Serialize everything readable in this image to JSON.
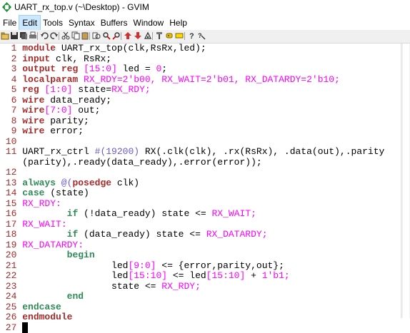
{
  "window": {
    "title": "UART_rx_top.v (~\\Desktop) - GVIM"
  },
  "menu": [
    "File",
    "Edit",
    "Tools",
    "Syntax",
    "Buffers",
    "Window",
    "Help"
  ],
  "menu_active_index": 1,
  "toolbar_icons": [
    "open-icon",
    "save-icon",
    "save-all-icon",
    "print-icon",
    "undo-icon",
    "redo-icon",
    "cut-icon",
    "copy-icon",
    "paste-icon",
    "replace-icon",
    "find-next-icon",
    "find-prev-icon",
    "load-session-icon",
    "save-session-icon",
    "run-script-icon",
    "make-icon",
    "shell-icon",
    "tags-icon",
    "help-icon",
    "find-help-icon"
  ],
  "colors": {
    "line_number": "#a52a2a",
    "keyword": "#a52a2a",
    "statement": "#2e8b57",
    "number": "#ff00ff",
    "special": "#6a5acd"
  },
  "lines": [
    {
      "n": "1",
      "segs": [
        {
          "t": "module",
          "c": "kw"
        },
        {
          "t": " UART_rx_top(clk,RsRx,led);"
        }
      ]
    },
    {
      "n": "2",
      "segs": [
        {
          "t": "input",
          "c": "kw"
        },
        {
          "t": " clk, RsRx;"
        }
      ]
    },
    {
      "n": "3",
      "segs": [
        {
          "t": "output",
          "c": "kw"
        },
        {
          "t": " "
        },
        {
          "t": "reg",
          "c": "kw"
        },
        {
          "t": " "
        },
        {
          "t": "[15:0]",
          "c": "num"
        },
        {
          "t": " led = "
        },
        {
          "t": "0",
          "c": "num"
        },
        {
          "t": ";"
        }
      ]
    },
    {
      "n": "4",
      "segs": [
        {
          "t": "localparam",
          "c": "kw"
        },
        {
          "t": " "
        },
        {
          "t": "RX_RDY=2'b00, RX_WAIT=2'b01, RX_DATARDY=2'b10;",
          "c": "num"
        }
      ]
    },
    {
      "n": "5",
      "segs": [
        {
          "t": "reg",
          "c": "kw"
        },
        {
          "t": " "
        },
        {
          "t": "[1:0]",
          "c": "num"
        },
        {
          "t": " state="
        },
        {
          "t": "RX_RDY;",
          "c": "num"
        }
      ]
    },
    {
      "n": "6",
      "segs": [
        {
          "t": "wire",
          "c": "kw"
        },
        {
          "t": " data_ready;"
        }
      ]
    },
    {
      "n": "7",
      "segs": [
        {
          "t": "wire",
          "c": "kw"
        },
        {
          "t": "[7:0]",
          "c": "num"
        },
        {
          "t": " out;"
        }
      ]
    },
    {
      "n": "8",
      "segs": [
        {
          "t": "wire",
          "c": "kw"
        },
        {
          "t": " parity;"
        }
      ]
    },
    {
      "n": "9",
      "segs": [
        {
          "t": "wire",
          "c": "kw"
        },
        {
          "t": " error;"
        }
      ]
    },
    {
      "n": "10",
      "segs": []
    },
    {
      "n": "11",
      "segs": [
        {
          "t": "UART_rx_ctrl "
        },
        {
          "t": "#(19200)",
          "c": "pp"
        },
        {
          "t": " RX(.clk(clk), .rx(RsRx), .data(out),.parity"
        }
      ]
    },
    {
      "n": "",
      "segs": [
        {
          "t": "(parity),.ready(data_ready),.error(error));"
        }
      ]
    },
    {
      "n": "12",
      "segs": []
    },
    {
      "n": "13",
      "segs": [
        {
          "t": "always",
          "c": "st"
        },
        {
          "t": " "
        },
        {
          "t": "@(",
          "c": "pp"
        },
        {
          "t": "posedge",
          "c": "kw"
        },
        {
          "t": " clk)"
        }
      ]
    },
    {
      "n": "14",
      "segs": [
        {
          "t": "case",
          "c": "st"
        },
        {
          "t": " (state)"
        }
      ]
    },
    {
      "n": "15",
      "segs": [
        {
          "t": "RX_RDY:",
          "c": "num"
        }
      ]
    },
    {
      "n": "16",
      "segs": [
        {
          "t": "        "
        },
        {
          "t": "if",
          "c": "st"
        },
        {
          "t": " (!data_ready) state <= "
        },
        {
          "t": "RX_WAIT;",
          "c": "num"
        }
      ]
    },
    {
      "n": "17",
      "segs": [
        {
          "t": "RX_WAIT:",
          "c": "num"
        }
      ]
    },
    {
      "n": "18",
      "segs": [
        {
          "t": "        "
        },
        {
          "t": "if",
          "c": "st"
        },
        {
          "t": " (data_ready) state <= "
        },
        {
          "t": "RX_DATARDY;",
          "c": "num"
        }
      ]
    },
    {
      "n": "19",
      "segs": [
        {
          "t": "RX_DATARDY:",
          "c": "num"
        }
      ]
    },
    {
      "n": "20",
      "segs": [
        {
          "t": "        "
        },
        {
          "t": "begin",
          "c": "st"
        }
      ]
    },
    {
      "n": "21",
      "segs": [
        {
          "t": "                led"
        },
        {
          "t": "[9:0]",
          "c": "num"
        },
        {
          "t": " <= {error,parity,out};"
        }
      ]
    },
    {
      "n": "22",
      "segs": [
        {
          "t": "                led"
        },
        {
          "t": "[15:10]",
          "c": "num"
        },
        {
          "t": " <= led"
        },
        {
          "t": "[15:10]",
          "c": "num"
        },
        {
          "t": " + "
        },
        {
          "t": "1'b1;",
          "c": "num"
        }
      ]
    },
    {
      "n": "23",
      "segs": [
        {
          "t": "                state <= "
        },
        {
          "t": "RX_RDY;",
          "c": "num"
        }
      ]
    },
    {
      "n": "24",
      "segs": [
        {
          "t": "        "
        },
        {
          "t": "end",
          "c": "st"
        }
      ]
    },
    {
      "n": "25",
      "segs": [
        {
          "t": "endcase",
          "c": "st"
        }
      ]
    },
    {
      "n": "26",
      "segs": [
        {
          "t": "endmodule",
          "c": "kw"
        }
      ]
    },
    {
      "n": "27",
      "segs": [
        {
          "t": "_",
          "c": "cursor"
        }
      ]
    }
  ]
}
